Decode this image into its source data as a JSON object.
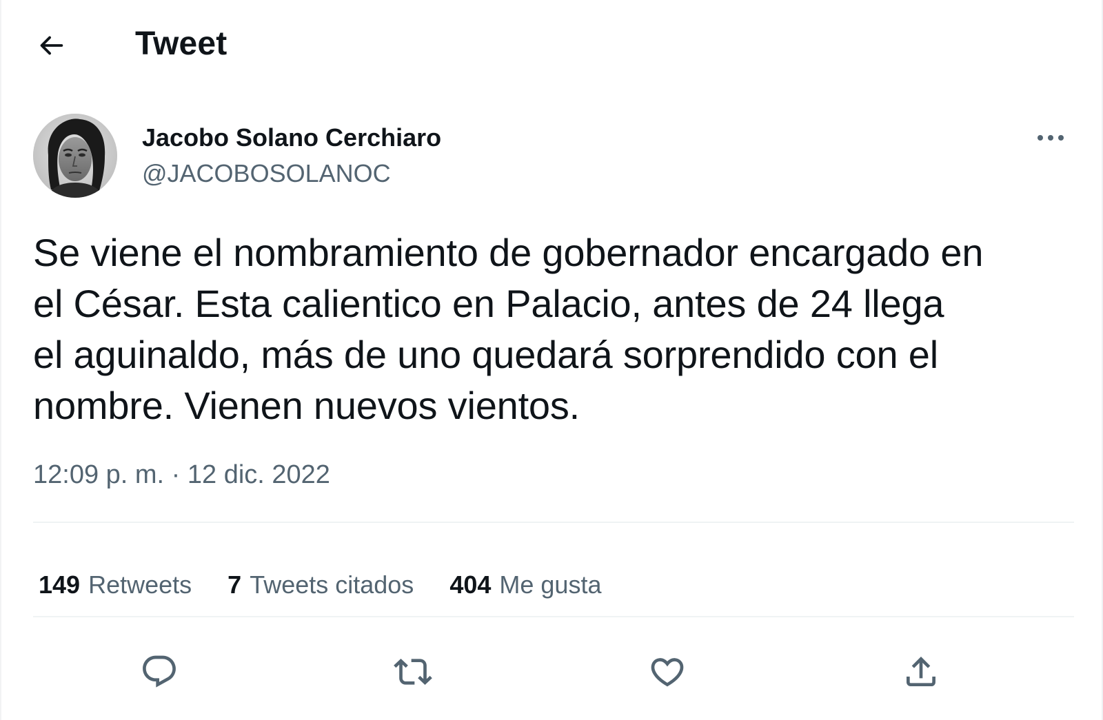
{
  "header": {
    "title": "Tweet",
    "back_icon": "arrow-left-icon"
  },
  "author": {
    "display_name": "Jacobo Solano Cerchiaro",
    "handle": "@JACOBOSOLANOC",
    "more_icon": "more-horizontal-icon"
  },
  "tweet": {
    "text": "Se viene el nombramiento de gobernador encargado en\nel César. Esta calientico en Palacio, antes de 24 llega\nel aguinaldo, más de uno quedará sorprendido con el\nnombre. Vienen nuevos vientos.",
    "timestamp": "12:09 p. m. · 12 dic. 2022"
  },
  "stats": [
    {
      "count": "149",
      "label": "Retweets"
    },
    {
      "count": "7",
      "label": "Tweets citados"
    },
    {
      "count": "404",
      "label": "Me gusta"
    }
  ],
  "actions": [
    {
      "icon": "reply-icon"
    },
    {
      "icon": "retweet-icon"
    },
    {
      "icon": "like-icon"
    },
    {
      "icon": "share-icon"
    }
  ],
  "colors": {
    "text_primary": "#0f1419",
    "text_secondary": "#536471",
    "divider": "#eff3f4"
  }
}
